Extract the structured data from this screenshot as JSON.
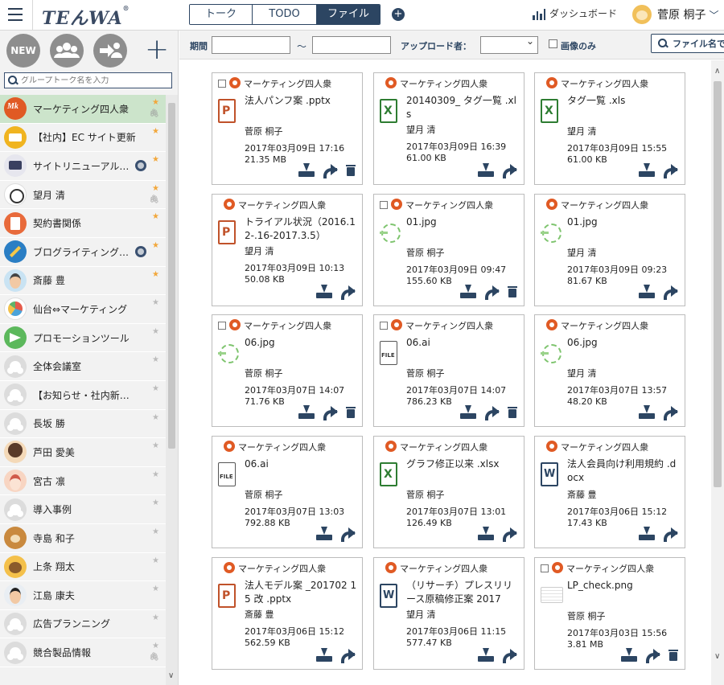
{
  "app": {
    "logo": "TEんWA",
    "logo_mark": "®"
  },
  "header": {
    "tabs": [
      {
        "label": "トーク",
        "active": false
      },
      {
        "label": "TODO",
        "active": false
      },
      {
        "label": "ファイル",
        "active": true
      }
    ],
    "add_icon": "plus-circle-icon",
    "dashboard_label": "ダッシュボード",
    "user_name": "菅原 桐子"
  },
  "sidebar": {
    "new_label": "NEW",
    "search_placeholder": "グループトーク名を入力",
    "items": [
      {
        "name": "マーケティング四人衆",
        "avatar": "mkt",
        "star": true,
        "clip": true,
        "selected": true,
        "status": false
      },
      {
        "name": "【社内】EC サイト更新",
        "avatar": "ec",
        "star": true,
        "clip": false,
        "selected": false,
        "status": false
      },
      {
        "name": "サイトリニューアル…",
        "avatar": "site",
        "star": true,
        "clip": false,
        "selected": false,
        "status": true
      },
      {
        "name": "望月 清",
        "avatar": "cat",
        "star": true,
        "clip": true,
        "selected": false,
        "status": false
      },
      {
        "name": "契約書関係",
        "avatar": "doc",
        "star": true,
        "clip": false,
        "selected": false,
        "status": false
      },
      {
        "name": "ブログライティング…",
        "avatar": "pen",
        "star": true,
        "clip": false,
        "selected": false,
        "status": true
      },
      {
        "name": "斎藤 豊",
        "avatar": "man",
        "star": true,
        "clip": false,
        "selected": false,
        "status": false
      },
      {
        "name": "仙台⇔マーケティング",
        "avatar": "pie",
        "star": false,
        "clip": false,
        "selected": false,
        "status": false
      },
      {
        "name": "プロモーションツール",
        "avatar": "promo",
        "star": false,
        "clip": false,
        "selected": false,
        "status": false
      },
      {
        "name": "全体会議室",
        "avatar": "grp",
        "star": false,
        "clip": false,
        "selected": false,
        "status": false
      },
      {
        "name": "【お知らせ・社内新…",
        "avatar": "grp",
        "star": false,
        "clip": false,
        "selected": false,
        "status": false
      },
      {
        "name": "長坂 勝",
        "avatar": "grp",
        "star": false,
        "clip": false,
        "selected": false,
        "status": false
      },
      {
        "name": "芦田 愛美",
        "avatar": "w1",
        "star": false,
        "clip": false,
        "selected": false,
        "status": false
      },
      {
        "name": "宮古 凛",
        "avatar": "w2",
        "star": false,
        "clip": false,
        "selected": false,
        "status": false
      },
      {
        "name": "導入事例",
        "avatar": "grp",
        "star": false,
        "clip": false,
        "selected": false,
        "status": false
      },
      {
        "name": "寺島 和子",
        "avatar": "dog",
        "star": false,
        "clip": false,
        "selected": false,
        "status": false
      },
      {
        "name": "上条 翔太",
        "avatar": "bear",
        "star": false,
        "clip": false,
        "selected": false,
        "status": false
      },
      {
        "name": "江島 康夫",
        "avatar": "m2",
        "star": false,
        "clip": false,
        "selected": false,
        "status": false
      },
      {
        "name": "広告プランニング",
        "avatar": "grp",
        "star": false,
        "clip": false,
        "selected": false,
        "status": false
      },
      {
        "name": "競合製品情報",
        "avatar": "grp",
        "star": false,
        "clip": true,
        "selected": false,
        "status": false
      }
    ]
  },
  "filter": {
    "period_label": "期間",
    "tilde": "〜",
    "uploader_label": "アップロード者：",
    "images_only_label": "画像のみ",
    "file_search_label": "ファイル名で"
  },
  "files": [
    {
      "group": "マーケティング四人衆",
      "checkbox": true,
      "type": "ppt",
      "name": "法人パンフ案 .pptx",
      "uploader": "菅原 桐子",
      "date": "2017年03月09日 17:16",
      "size": "21.35 MB",
      "delete": true
    },
    {
      "group": "マーケティング四人衆",
      "checkbox": false,
      "type": "xls",
      "name": "20140309_ タグ一覧 .xls",
      "uploader": "望月 清",
      "date": "2017年03月09日 16:39",
      "size": "61.00 KB",
      "delete": false
    },
    {
      "group": "マーケティング四人衆",
      "checkbox": false,
      "type": "xls",
      "name": "タグ一覧 .xls",
      "uploader": "望月 清",
      "date": "2017年03月09日 15:55",
      "size": "61.00 KB",
      "delete": false
    },
    {
      "group": "マーケティング四人衆",
      "checkbox": false,
      "type": "ppt",
      "name": "トライアル状況（2016.12-.16-2017.3.5）",
      "uploader": "望月 清",
      "date": "2017年03月09日 10:13",
      "size": "50.08 KB",
      "delete": false
    },
    {
      "group": "マーケティング四人衆",
      "checkbox": true,
      "type": "img",
      "name": "01.jpg",
      "uploader": "菅原 桐子",
      "date": "2017年03月09日 09:47",
      "size": "155.60 KB",
      "delete": true
    },
    {
      "group": "マーケティング四人衆",
      "checkbox": false,
      "type": "img",
      "name": "01.jpg",
      "uploader": "望月 清",
      "date": "2017年03月09日 09:23",
      "size": "81.67 KB",
      "delete": false
    },
    {
      "group": "マーケティング四人衆",
      "checkbox": true,
      "type": "img",
      "name": "06.jpg",
      "uploader": "菅原 桐子",
      "date": "2017年03月07日 14:07",
      "size": "71.76 KB",
      "delete": true
    },
    {
      "group": "マーケティング四人衆",
      "checkbox": true,
      "type": "file",
      "name": "06.ai",
      "uploader": "菅原 桐子",
      "date": "2017年03月07日 14:07",
      "size": "786.23 KB",
      "delete": true
    },
    {
      "group": "マーケティング四人衆",
      "checkbox": false,
      "type": "img",
      "name": "06.jpg",
      "uploader": "望月 清",
      "date": "2017年03月07日 13:57",
      "size": "48.20 KB",
      "delete": false
    },
    {
      "group": "マーケティング四人衆",
      "checkbox": false,
      "type": "file",
      "name": "06.ai",
      "uploader": "菅原 桐子",
      "date": "2017年03月07日 13:03",
      "size": "792.88 KB",
      "delete": false
    },
    {
      "group": "マーケティング四人衆",
      "checkbox": false,
      "type": "xls",
      "name": "グラフ修正以来 .xlsx",
      "uploader": "菅原 桐子",
      "date": "2017年03月07日 13:01",
      "size": "126.49 KB",
      "delete": false
    },
    {
      "group": "マーケティング四人衆",
      "checkbox": false,
      "type": "doc",
      "name": "法人会員向け利用規約 .docx",
      "uploader": "斎藤 豊",
      "date": "2017年03月06日 15:12",
      "size": "17.43 KB",
      "delete": false
    },
    {
      "group": "マーケティング四人衆",
      "checkbox": false,
      "type": "ppt",
      "name": "法人モデル案 _201702 15 改 .pptx",
      "uploader": "斎藤 豊",
      "date": "2017年03月06日 15:12",
      "size": "562.59 KB",
      "delete": false
    },
    {
      "group": "マーケティング四人衆",
      "checkbox": false,
      "type": "doc",
      "name": "（リサーチ）プレスリリース原稿修正案 2017",
      "uploader": "望月 清",
      "date": "2017年03月06日 11:15",
      "size": "577.47 KB",
      "delete": false
    },
    {
      "group": "マーケティング四人衆",
      "checkbox": true,
      "type": "lp",
      "name": "LP_check.png",
      "uploader": "菅原 桐子",
      "date": "2017年03月03日 15:56",
      "size": "3.81 MB",
      "delete": true
    }
  ]
}
